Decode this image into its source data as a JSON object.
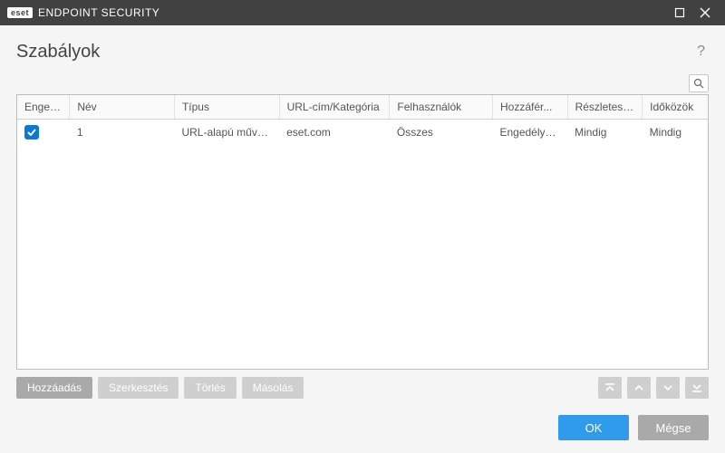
{
  "titlebar": {
    "brand_logo": "eset",
    "brand_name": "ENDPOINT SECURITY"
  },
  "page": {
    "title": "Szabályok"
  },
  "table": {
    "headers": {
      "enabled": "Engedé...",
      "name": "Név",
      "type": "Típus",
      "url": "URL-cím/Kategória",
      "users": "Felhasználók",
      "access": "Hozzáfér...",
      "severity": "Részletess...",
      "intervals": "Időközök"
    },
    "rows": [
      {
        "enabled": true,
        "name": "1",
        "type": "URL-alapú művelet",
        "url": "eset.com",
        "users": "Összes",
        "access": "Engedélyezés",
        "severity": "Mindig",
        "intervals": "Mindig"
      }
    ]
  },
  "toolbar": {
    "add": "Hozzáadás",
    "edit": "Szerkesztés",
    "delete": "Törlés",
    "copy": "Másolás"
  },
  "footer": {
    "ok": "OK",
    "cancel": "Mégse"
  }
}
